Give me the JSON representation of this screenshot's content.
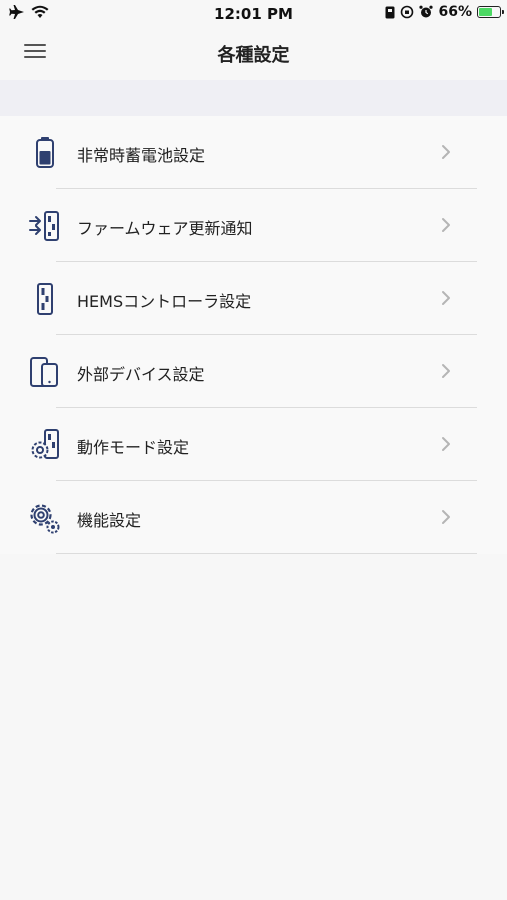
{
  "status_bar": {
    "time": "12:01 PM",
    "battery_percent_text": "66%",
    "battery_level": 0.66,
    "left_icons": [
      "airplane-icon",
      "wifi-icon"
    ],
    "right_icons": [
      "sim-icon",
      "orientation-lock-icon",
      "alarm-icon",
      "battery-icon"
    ]
  },
  "nav": {
    "title": "各種設定",
    "menu_icon": "hamburger-icon"
  },
  "colors": {
    "icon_navy": "#2f4070",
    "chevron": "#b5b5b5",
    "divider": "#dcdcdc",
    "section_gap": "#efeff4",
    "battery_green": "#4cd964"
  },
  "menu_items": [
    {
      "label": "非常時蓄電池設定",
      "icon": "battery-storage-icon"
    },
    {
      "label": "ファームウェア更新通知",
      "icon": "firmware-update-icon"
    },
    {
      "label": "HEMSコントローラ設定",
      "icon": "hems-controller-icon"
    },
    {
      "label": "外部デバイス設定",
      "icon": "external-device-icon"
    },
    {
      "label": "動作モード設定",
      "icon": "operation-mode-icon"
    },
    {
      "label": "機能設定",
      "icon": "settings-gear-icon"
    }
  ]
}
